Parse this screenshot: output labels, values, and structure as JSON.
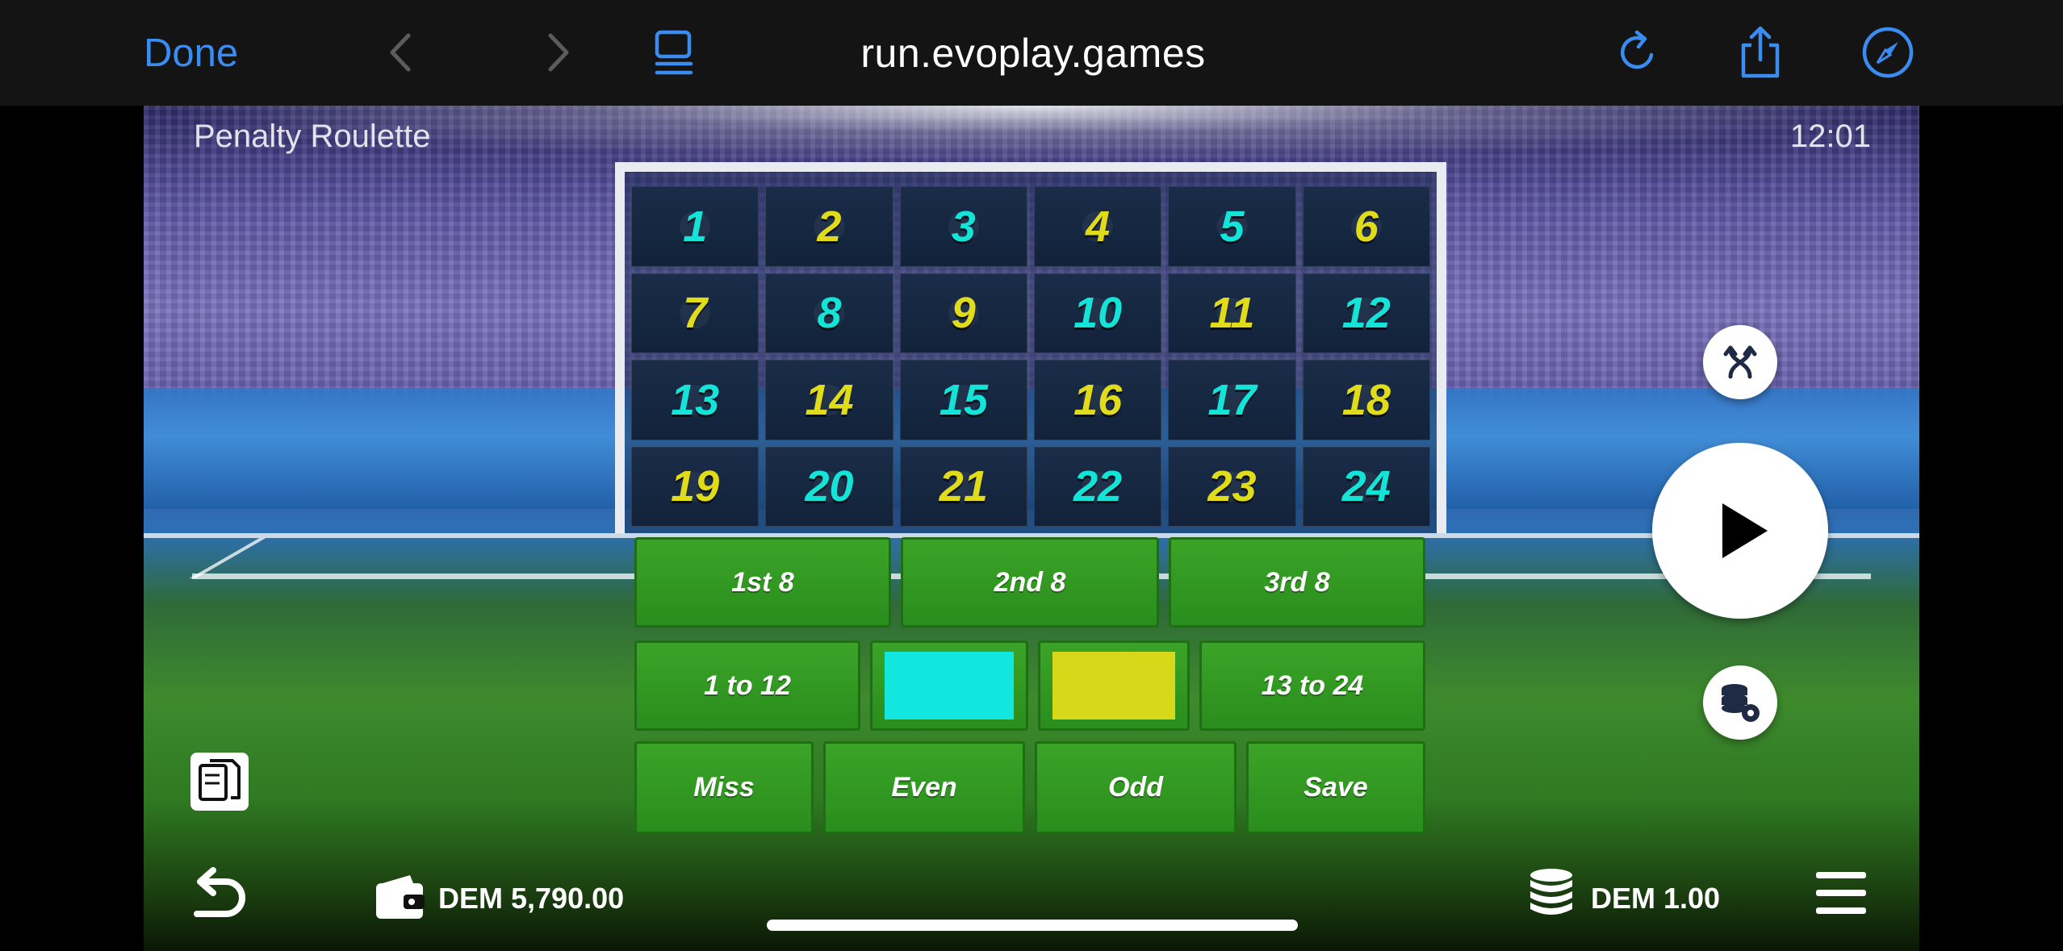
{
  "browser": {
    "done_label": "Done",
    "url": "run.evoplay.games",
    "icons": [
      "back-icon",
      "forward-icon",
      "tabs-icon",
      "reload-icon",
      "share-icon",
      "compass-icon"
    ],
    "accent_color": "#3b8cf0"
  },
  "game": {
    "title": "Penalty Roulette",
    "clock": "12:01",
    "numbers": [
      {
        "label": "1",
        "color": "cyan"
      },
      {
        "label": "2",
        "color": "yellow"
      },
      {
        "label": "3",
        "color": "cyan"
      },
      {
        "label": "4",
        "color": "yellow"
      },
      {
        "label": "5",
        "color": "cyan"
      },
      {
        "label": "6",
        "color": "yellow"
      },
      {
        "label": "7",
        "color": "yellow"
      },
      {
        "label": "8",
        "color": "cyan"
      },
      {
        "label": "9",
        "color": "yellow"
      },
      {
        "label": "10",
        "color": "cyan"
      },
      {
        "label": "11",
        "color": "yellow"
      },
      {
        "label": "12",
        "color": "cyan"
      },
      {
        "label": "13",
        "color": "cyan"
      },
      {
        "label": "14",
        "color": "yellow"
      },
      {
        "label": "15",
        "color": "cyan"
      },
      {
        "label": "16",
        "color": "yellow"
      },
      {
        "label": "17",
        "color": "cyan"
      },
      {
        "label": "18",
        "color": "yellow"
      },
      {
        "label": "19",
        "color": "yellow"
      },
      {
        "label": "20",
        "color": "cyan"
      },
      {
        "label": "21",
        "color": "yellow"
      },
      {
        "label": "22",
        "color": "cyan"
      },
      {
        "label": "23",
        "color": "yellow"
      },
      {
        "label": "24",
        "color": "cyan"
      }
    ],
    "number_colors": {
      "cyan": "#14e3d8",
      "yellow": "#e0dc1a"
    },
    "bets": {
      "dozen_1": "1st 8",
      "dozen_2": "2nd 8",
      "dozen_3": "3rd 8",
      "low": "1 to 12",
      "high": "13 to 24",
      "miss": "Miss",
      "even": "Even",
      "odd": "Odd",
      "save": "Save"
    },
    "swatch_colors": {
      "cyan": "#12e6de",
      "yellow": "#d8d81a"
    }
  },
  "footer": {
    "balance": "DEM 5,790.00",
    "bet": "DEM 1.00",
    "icons": [
      "rules-icon",
      "undo-icon",
      "wallet-icon",
      "chip-stack-icon",
      "menu-icon",
      "swap-arrows-icon",
      "play-icon",
      "auto-bet-settings-icon"
    ]
  }
}
